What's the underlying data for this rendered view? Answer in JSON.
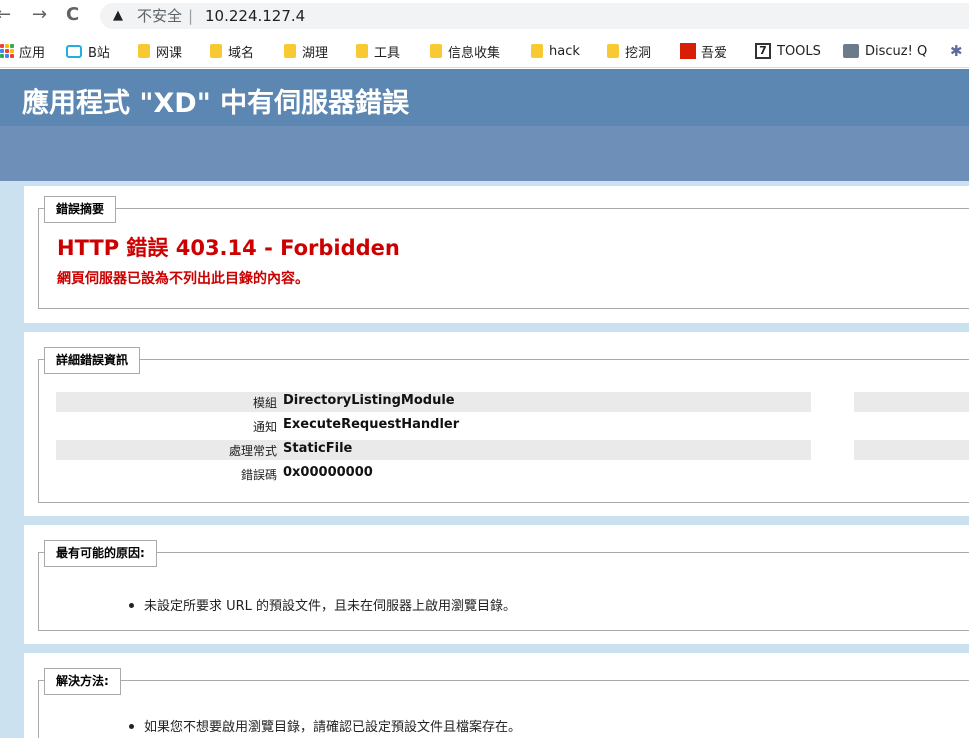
{
  "browser": {
    "back_icon": "←",
    "forward_icon": "→",
    "reload_icon": "C",
    "security_icon": "▲",
    "security_label": "不安全",
    "url_separator": "|",
    "url": "10.224.127.4"
  },
  "bookmarks": [
    {
      "label": "应用",
      "icon": "apps-grid-icon"
    },
    {
      "label": "B站",
      "icon": "bilibili-icon"
    },
    {
      "label": "网课",
      "icon": "folder-icon"
    },
    {
      "label": "域名",
      "icon": "folder-icon"
    },
    {
      "label": "湖理",
      "icon": "folder-icon"
    },
    {
      "label": "工具",
      "icon": "folder-icon"
    },
    {
      "label": "信息收集",
      "icon": "folder-icon"
    },
    {
      "label": "hack",
      "icon": "folder-icon"
    },
    {
      "label": "挖洞",
      "icon": "folder-icon"
    },
    {
      "label": "吾爱",
      "icon": "52pojie-icon"
    },
    {
      "label": "TOOLS",
      "icon": "seven-icon"
    },
    {
      "label": "Discuz! Q",
      "icon": "discuz-icon"
    }
  ],
  "page": {
    "title": "應用程式 \"XD\" 中有伺服器錯誤",
    "summary": {
      "legend": "錯誤摘要",
      "error_title": "HTTP 錯誤 403.14 - Forbidden",
      "error_message": "網頁伺服器已設為不列出此目錄的內容。"
    },
    "details": {
      "legend": "詳細錯誤資訊",
      "rows": [
        {
          "label": "模組",
          "value": "DirectoryListingModule"
        },
        {
          "label": "通知",
          "value": "ExecuteRequestHandler"
        },
        {
          "label": "處理常式",
          "value": "StaticFile"
        },
        {
          "label": "錯誤碼",
          "value": "0x00000000"
        }
      ]
    },
    "causes": {
      "legend": "最有可能的原因:",
      "items": [
        "未設定所要求 URL 的預設文件，且未在伺服器上啟用瀏覽目錄。"
      ]
    },
    "solutions": {
      "legend": "解決方法:",
      "items": [
        "如果您不想要啟用瀏覽目錄，請確認已設定預設文件且檔案存在。"
      ]
    }
  },
  "colors": {
    "header": "#5c87b2",
    "subheader": "#6e8fb8",
    "background": "#cbe1ef",
    "error_red": "#cc0000"
  }
}
